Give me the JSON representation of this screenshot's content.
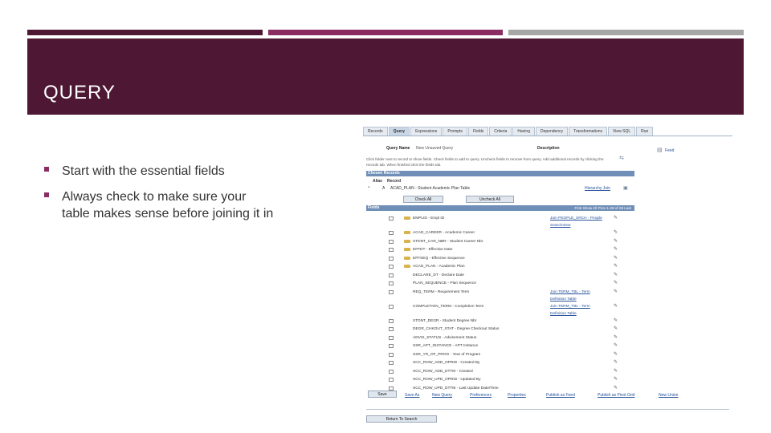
{
  "slide": {
    "title": "QUERY",
    "bullets": [
      "Start with the essential fields",
      "Always check to make sure your table makes sense before joining it  in"
    ],
    "colors": {
      "band": "#4e1734",
      "accent_bar": "#8a2d63",
      "gray_bar": "#a6a6a6"
    }
  },
  "query_screen": {
    "tabs": [
      "Records",
      "Query",
      "Expressions",
      "Prompts",
      "Fields",
      "Criteria",
      "Having",
      "Dependency",
      "Transformations",
      "View SQL",
      "Run"
    ],
    "active_tab": "Query",
    "query_name_label": "Query Name",
    "query_name_value": "New Unsaved Query",
    "description_label": "Description",
    "feed_label": "Feed",
    "instructions": "Click folder next to record to show fields. Check fields to add to query. Uncheck fields to remove from query. Add additional records by clicking the records tab. When finished click the fields tab.",
    "chosen_records_label": "Chosen Records",
    "alias_header": "Alias",
    "record_header": "Record",
    "record_alias": "A",
    "record_name": "ACAD_PLAN - Student Academic Plan Table",
    "hierarchy_join_label": "Hierarchy Join",
    "check_all_label": "Check All",
    "uncheck_all_label": "Uncheck All",
    "fields_label": "Fields",
    "fields_nav": "First  Show All  Prev  1-28 of 28  Last",
    "fields": [
      {
        "name": "EMPLID - Empl ID",
        "join": "Join PEOPLE_SRCH - People",
        "join2": "SearchView",
        "key": true
      },
      {
        "name": "ACAD_CAREER - Academic Career",
        "join": "",
        "key": true
      },
      {
        "name": "STDNT_CAR_NBR - Student Career Nbr",
        "join": "",
        "key": true
      },
      {
        "name": "EFFDT - Effective Date",
        "join": "",
        "key": true
      },
      {
        "name": "EFFSEQ - Effective Sequence",
        "join": "",
        "key": true
      },
      {
        "name": "ACAD_PLAN - Academic Plan",
        "join": "",
        "key": true
      },
      {
        "name": "DECLARE_DT - Declare Date",
        "join": "",
        "key": false
      },
      {
        "name": "PLAN_SEQUENCE - Plan Sequence",
        "join": "",
        "key": false
      },
      {
        "name": "REQ_TERM - Requirement Term",
        "join": "Join TERM_TBL - Term",
        "join2": "Definition Table",
        "key": false
      },
      {
        "name": "COMPLETION_TERM - Completion Term",
        "join": "Join TERM_TBL - Term",
        "join2": "Definition Table",
        "key": false
      },
      {
        "name": "STDNT_DEGR - Student Degree Nbr",
        "join": "",
        "key": false
      },
      {
        "name": "DEGR_CHKOUT_STAT - Degree Checkout Status",
        "join": "",
        "key": false
      },
      {
        "name": "ADVIS_STATUS - Advisement Status",
        "join": "",
        "key": false
      },
      {
        "name": "SSR_APT_INSTANCE - APT Instance",
        "join": "",
        "key": false
      },
      {
        "name": "SSR_YR_OF_PROG - Year of Program",
        "join": "",
        "key": false
      },
      {
        "name": "SCC_ROW_ADD_OPRID - Created By",
        "join": "",
        "key": false
      },
      {
        "name": "SCC_ROW_ADD_DTTM - Created",
        "join": "",
        "key": false
      },
      {
        "name": "SCC_ROW_UPD_OPRID - Updated By",
        "join": "",
        "key": false
      },
      {
        "name": "SCC_ROW_UPD_DTTM - Last Update Date/Time",
        "join": "",
        "key": false
      }
    ],
    "bottom_actions": {
      "save": "Save",
      "save_as": "Save As",
      "new_query": "New Query",
      "preferences": "Preferences",
      "properties": "Properties",
      "publish_feed": "Publish as Feed",
      "publish_pivot": "Publish as Pivot Grid",
      "new_union": "New Union",
      "return_to_search": "Return To Search"
    }
  }
}
